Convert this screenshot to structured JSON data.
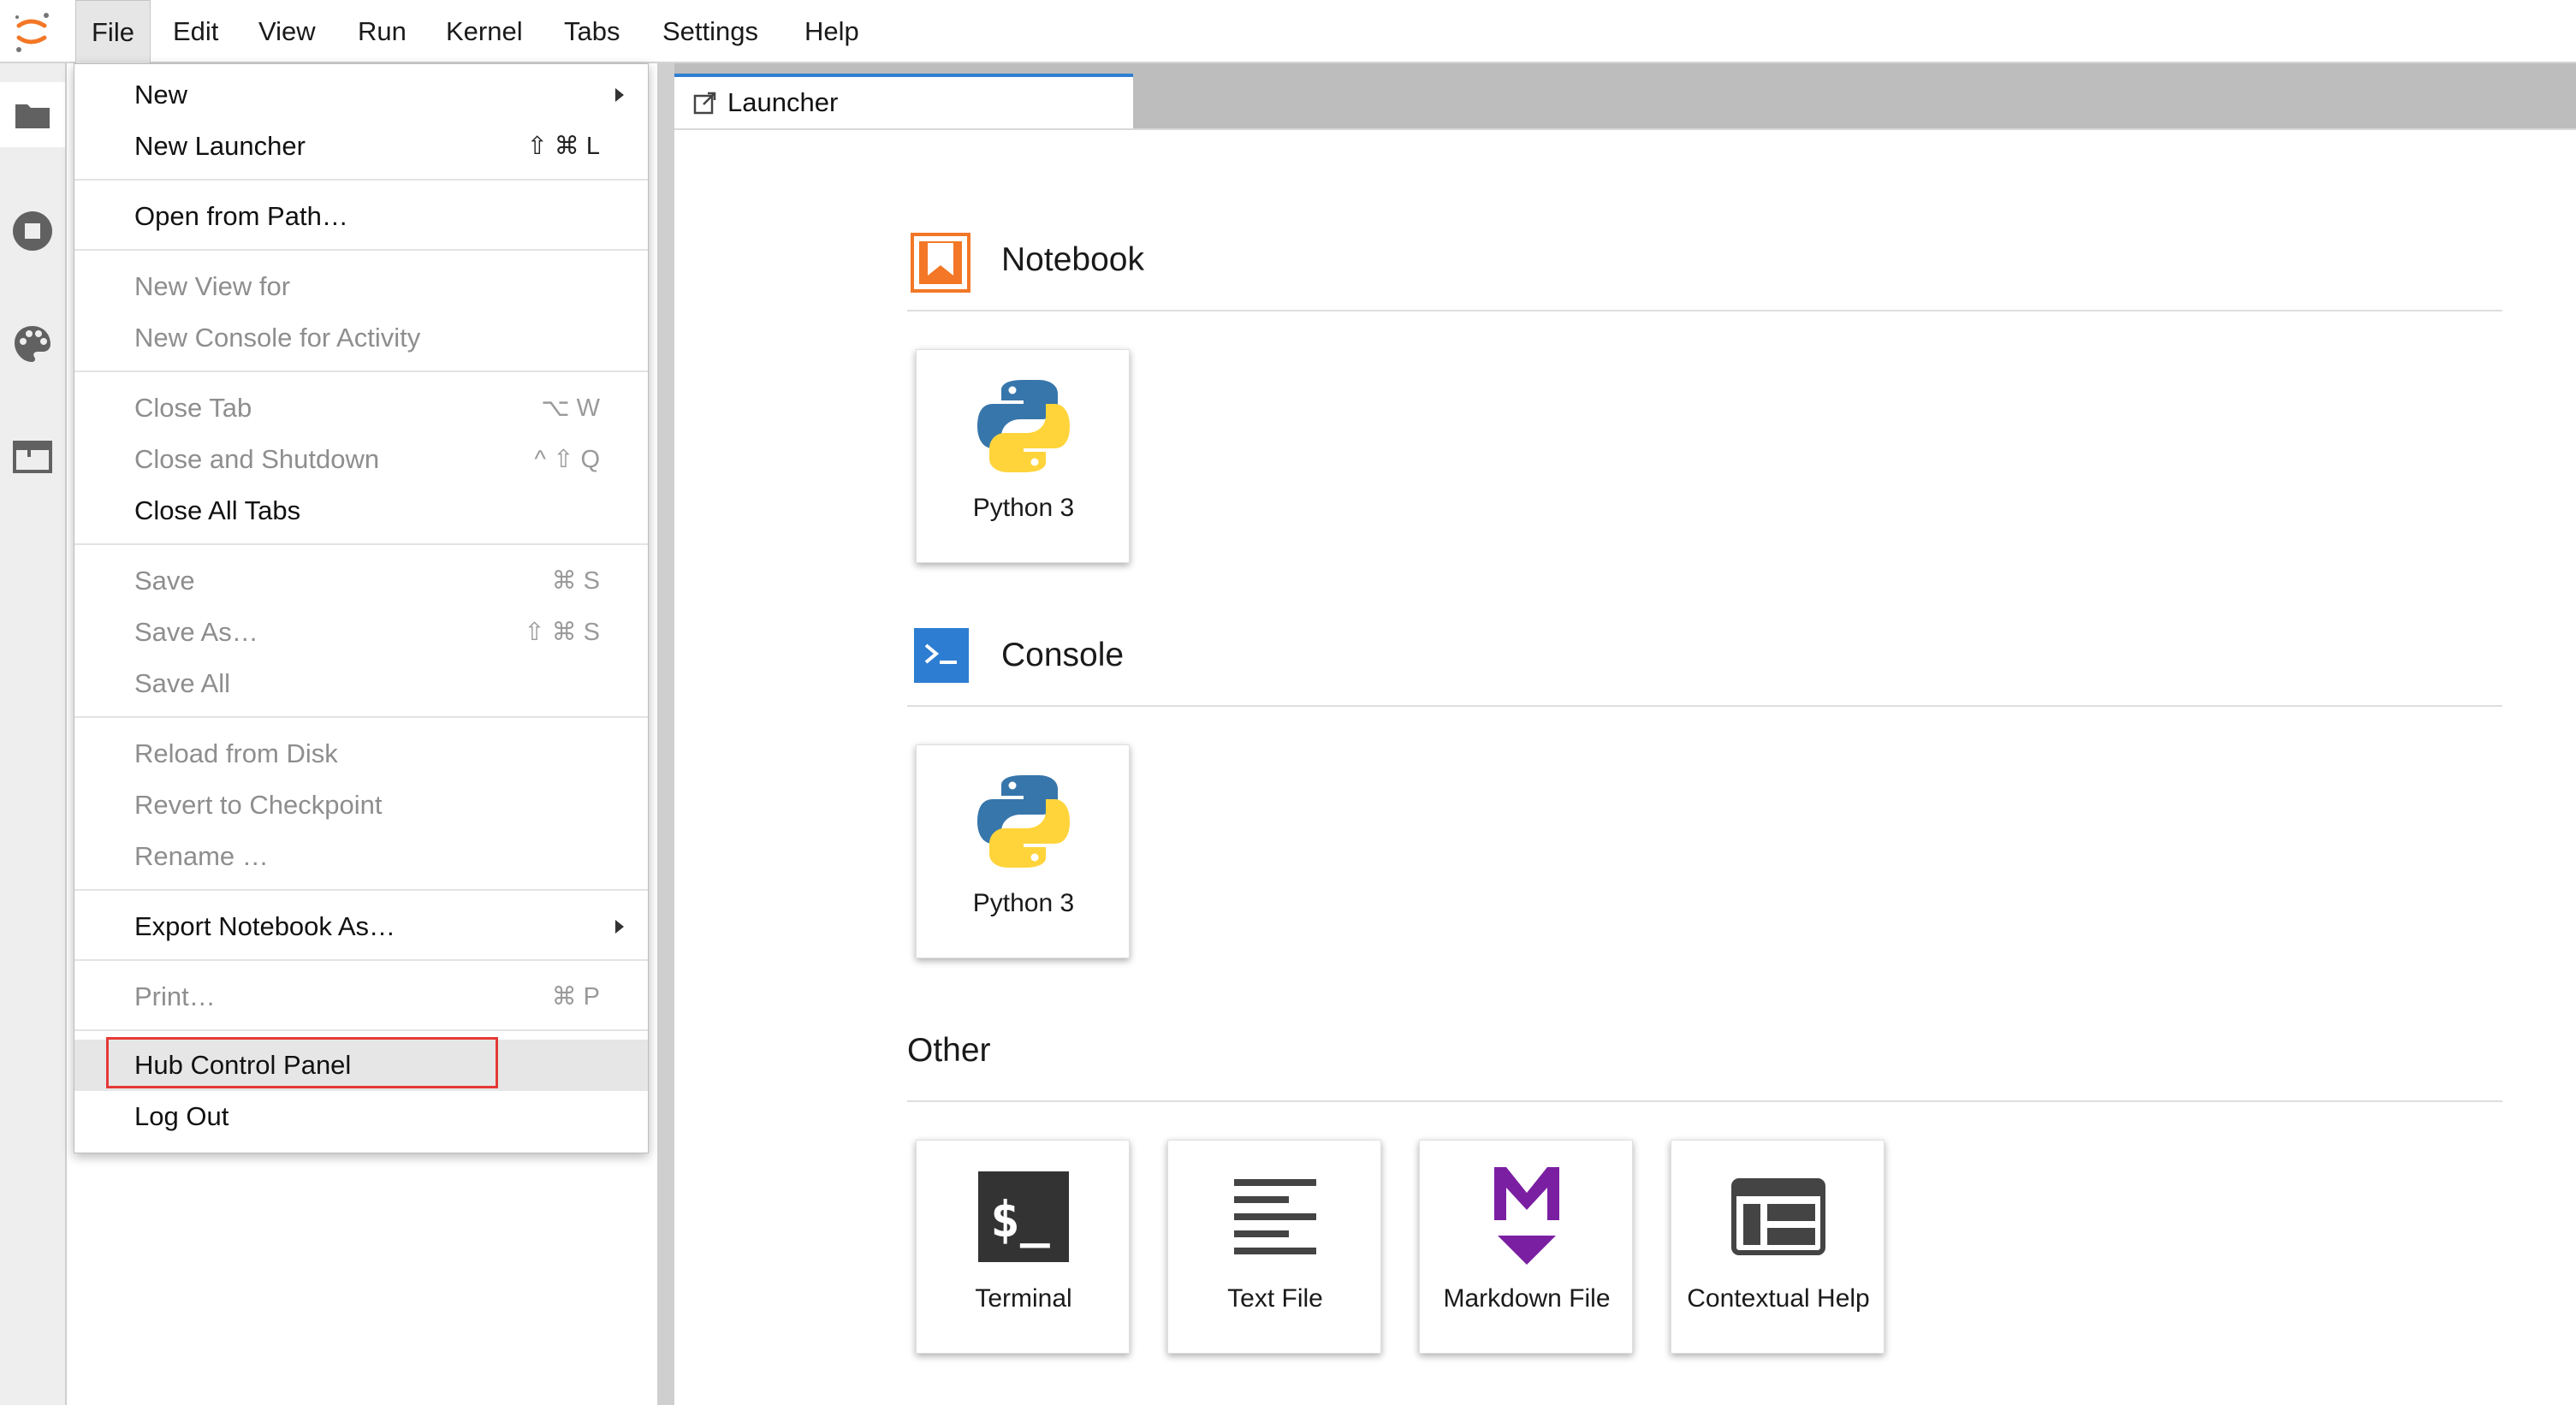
{
  "menubar": {
    "items": [
      "File",
      "Edit",
      "View",
      "Run",
      "Kernel",
      "Tabs",
      "Settings",
      "Help"
    ],
    "active": "File"
  },
  "sidebar": {
    "icons": [
      "folder-icon",
      "running-icon",
      "palette-icon",
      "tabs-icon"
    ]
  },
  "file_menu": {
    "items": [
      {
        "label": "New",
        "shortcut": "",
        "submenu": true,
        "disabled": false
      },
      {
        "label": "New Launcher",
        "shortcut": "⇧ ⌘ L",
        "submenu": false,
        "disabled": false
      },
      {
        "label": "Open from Path…",
        "shortcut": "",
        "submenu": false,
        "disabled": false
      },
      {
        "label": "New View for",
        "shortcut": "",
        "submenu": false,
        "disabled": true
      },
      {
        "label": "New Console for Activity",
        "shortcut": "",
        "submenu": false,
        "disabled": true
      },
      {
        "label": "Close Tab",
        "shortcut": "⌥ W",
        "submenu": false,
        "disabled": true
      },
      {
        "label": "Close and Shutdown",
        "shortcut": "^ ⇧ Q",
        "submenu": false,
        "disabled": true
      },
      {
        "label": "Close All Tabs",
        "shortcut": "",
        "submenu": false,
        "disabled": false
      },
      {
        "label": "Save",
        "shortcut": "⌘ S",
        "submenu": false,
        "disabled": true
      },
      {
        "label": "Save As…",
        "shortcut": "⇧ ⌘ S",
        "submenu": false,
        "disabled": true
      },
      {
        "label": "Save All",
        "shortcut": "",
        "submenu": false,
        "disabled": true
      },
      {
        "label": "Reload from Disk",
        "shortcut": "",
        "submenu": false,
        "disabled": true
      },
      {
        "label": "Revert to Checkpoint",
        "shortcut": "",
        "submenu": false,
        "disabled": true
      },
      {
        "label": "Rename …",
        "shortcut": "",
        "submenu": false,
        "disabled": true
      },
      {
        "label": "Export Notebook As…",
        "shortcut": "",
        "submenu": true,
        "disabled": false
      },
      {
        "label": "Print…",
        "shortcut": "⌘ P",
        "submenu": false,
        "disabled": true
      },
      {
        "label": "Hub Control Panel",
        "shortcut": "",
        "submenu": false,
        "disabled": false,
        "highlighted": true
      },
      {
        "label": "Log Out",
        "shortcut": "",
        "submenu": false,
        "disabled": false
      }
    ]
  },
  "tab": {
    "label": "Launcher"
  },
  "launcher": {
    "notebook": {
      "title": "Notebook",
      "cards": [
        {
          "label": "Python 3"
        }
      ]
    },
    "console": {
      "title": "Console",
      "cards": [
        {
          "label": "Python 3"
        }
      ]
    },
    "other": {
      "title": "Other",
      "cards": [
        {
          "label": "Terminal"
        },
        {
          "label": "Text File"
        },
        {
          "label": "Markdown File"
        },
        {
          "label": "Contextual Help"
        }
      ]
    }
  },
  "colors": {
    "accent_orange": "#f37726",
    "console_blue": "#2d7dd2",
    "markdown_purple": "#7b1fa2",
    "highlight_red": "#e53935",
    "tab_accent": "#2f7fd1"
  }
}
